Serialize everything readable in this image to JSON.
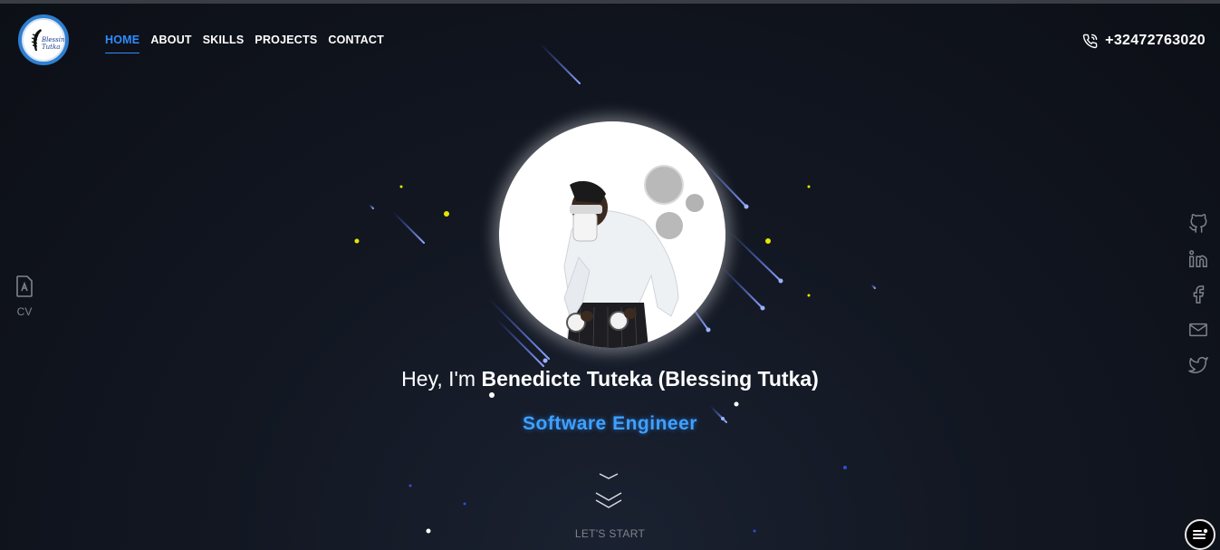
{
  "brand": {
    "logo_text_line1": "Blessing",
    "logo_text_line2": "Tutka"
  },
  "nav": {
    "items": [
      {
        "label": "HOME",
        "active": true
      },
      {
        "label": "ABOUT",
        "active": false
      },
      {
        "label": "SKILLS",
        "active": false
      },
      {
        "label": "PROJECTS",
        "active": false
      },
      {
        "label": "CONTACT",
        "active": false
      }
    ]
  },
  "contact": {
    "phone": "+32472763020",
    "icon": "phone-icon"
  },
  "sidebar_left": {
    "cv_label": "CV",
    "icon": "document-icon"
  },
  "socials": [
    "github-icon",
    "linkedin-icon",
    "facebook-icon",
    "mail-icon",
    "twitter-icon"
  ],
  "hero": {
    "greeting_prefix": "Hey, I'm ",
    "name": "Benedicte Tuteka (Blessing Tutka)",
    "role": "Software Engineer",
    "cta": "LET'S START"
  },
  "colors": {
    "accent": "#2f8cff",
    "background": "#121722",
    "muted": "#7e838c"
  }
}
